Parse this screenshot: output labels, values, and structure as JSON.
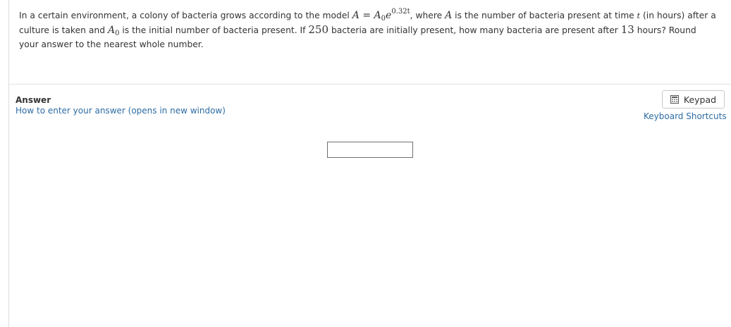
{
  "question": {
    "part1": "In a certain environment, a colony of bacteria grows according to the model ",
    "model_lhs": "A",
    "model_eq": " = ",
    "model_a": "A",
    "model_a_sub": "0",
    "model_e": "e",
    "model_exp": "0.32t",
    "part2": ", where ",
    "var_a": "A",
    "part3": " is the number of bacteria present at time ",
    "var_t": "t",
    "part4": " (in hours) after a culture is taken and ",
    "var_a0": "A",
    "var_a0_sub": "0",
    "part5": " is the initial number of bacteria present.  If ",
    "initial_count": "250",
    "part6": " bacteria are initially present, how many bacteria are present after ",
    "hours": "13",
    "part7": " hours? Round your answer to the nearest whole number."
  },
  "answer": {
    "label": "Answer",
    "howto_link": "How to enter your answer (opens in new window)",
    "input_value": ""
  },
  "tools": {
    "keypad_label": "Keypad",
    "keypad_icon": "calculator-icon",
    "shortcuts_link": "Keyboard Shortcuts"
  },
  "colors": {
    "link": "#2e6ca4",
    "text": "#333333",
    "divider": "#e4e4e4"
  }
}
